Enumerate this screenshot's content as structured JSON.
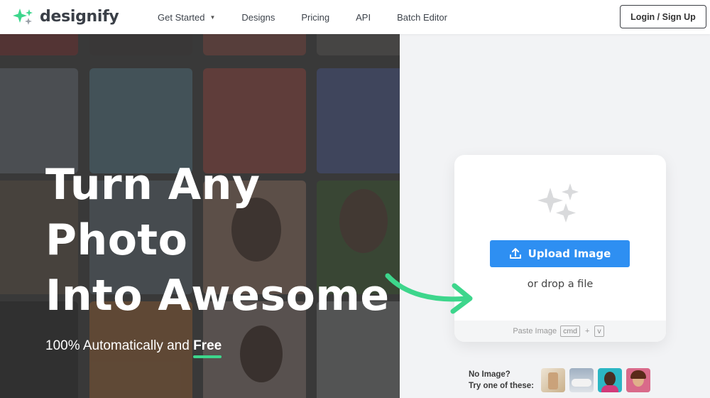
{
  "brand": {
    "name": "designify"
  },
  "nav": {
    "items": [
      {
        "label": "Get Started",
        "has_dropdown": true
      },
      {
        "label": "Designs"
      },
      {
        "label": "Pricing"
      },
      {
        "label": "API"
      },
      {
        "label": "Batch Editor"
      }
    ],
    "login_label": "Login / Sign Up"
  },
  "hero": {
    "title_lines": [
      "Turn Any",
      "Photo",
      "Into Awesome"
    ],
    "subtitle": "100% Automatically and",
    "subtitle_emphasis": "Free"
  },
  "upload": {
    "button_label": "Upload Image",
    "drop_text": "or drop a file",
    "paste_label": "Paste Image",
    "key_cmd": "cmd",
    "key_plus": "+",
    "key_v": "v"
  },
  "samples": {
    "line1": "No Image?",
    "line2": "Try one of these:"
  },
  "colors": {
    "brand_green": "#3dd68c",
    "upload_blue": "#2e8ff2"
  },
  "icons": [
    "sparkle-logo-icon",
    "chevron-down-icon",
    "upload-icon",
    "sparkle-icon",
    "arrow-icon"
  ]
}
